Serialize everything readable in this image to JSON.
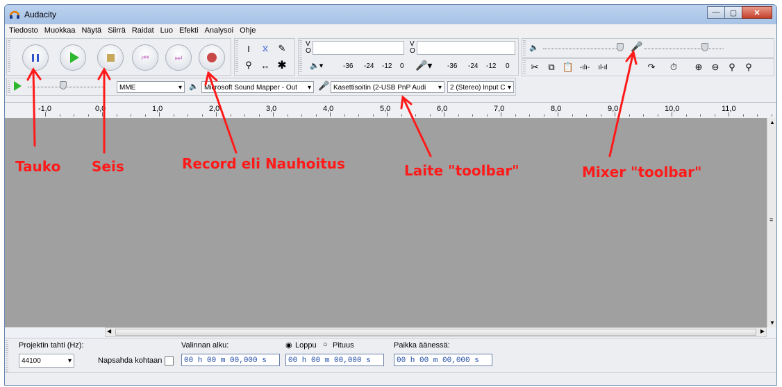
{
  "window": {
    "title": "Audacity"
  },
  "menu": [
    "Tiedosto",
    "Muokkaa",
    "Näytä",
    "Siirrä",
    "Raidat",
    "Luo",
    "Efekti",
    "Analysoi",
    "Ohje"
  ],
  "meter": {
    "v_label": "V",
    "o_label": "O",
    "scale": [
      "-36",
      "-24",
      "-12",
      "0"
    ]
  },
  "device": {
    "host": "MME",
    "output": "Microsoft Sound Mapper - Out",
    "input": "Kasettisoitin (2-USB PnP Audi",
    "channels": "2 (Stereo) Input C"
  },
  "ruler": [
    "-1,0",
    "0,0",
    "1,0",
    "2,0",
    "3,0",
    "4,0",
    "5,0",
    "6,0",
    "7,0",
    "8,0",
    "9,0",
    "10,0",
    "11,0"
  ],
  "selection": {
    "rate_label": "Projektin tahti (Hz):",
    "rate_value": "44100",
    "snap_label": "Napsahda kohtaan",
    "start_label": "Valinnan alku:",
    "end_label": "Loppu",
    "length_label": "Pituus",
    "position_label": "Paikka äänessä:",
    "time_start": "00 h 00 m 00,000 s",
    "time_end": "00 h 00 m 00,000 s",
    "time_pos": "00 h 00 m 00,000 s"
  },
  "annotations": {
    "pause": "Tauko",
    "stop": "Seis",
    "record": "Record eli Nauhoitus",
    "device": "Laite \"toolbar\"",
    "mixer": "Mixer \"toolbar\""
  },
  "colors": {
    "annotation": "#ff1a1a",
    "track_bg": "#a0a0a0"
  }
}
